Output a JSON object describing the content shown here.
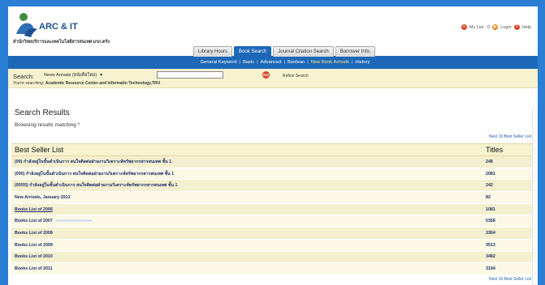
{
  "header": {
    "logo_text": "ARC & IT",
    "logo_subtitle": "สำนักวิทยบริการและเทคโนโลยีสารสนเทศ มรภ.ตรัง",
    "links": [
      "My List - 0",
      "Login",
      "Help"
    ]
  },
  "tabs": [
    {
      "label": "Library Hours",
      "active": false
    },
    {
      "label": "Book Search",
      "active": true
    },
    {
      "label": "Journal Citation Search",
      "active": false
    },
    {
      "label": "Borrower Info.",
      "active": false
    }
  ],
  "nav": {
    "items": [
      "General Keyword",
      "Basic",
      "Advanced",
      "Boolean",
      "New Book Arrivals",
      "History"
    ],
    "current": "New Book Arrivals"
  },
  "search": {
    "label": "Search:",
    "selected_option": "News Arrivals (หนังสือใหม่)",
    "input_value": "",
    "go_label": "GO",
    "refine_label": "Refine Search",
    "searching_prefix": "You're searching:",
    "searching_value": "Academic Resource Center and Informatin Technology,TRU"
  },
  "results": {
    "title": "Search Results",
    "browsing_text": "Browsing results matching *",
    "next_label": "Next 10 Best Seller List",
    "table": {
      "col_list": "Best Seller List",
      "col_titles": "Titles",
      "rows": [
        {
          "name": "(00) กำลังอยู่ในขั้นดำเนินการ สนใจติดต่อฝ่ายงานวิเคราะห์ทรัพยากรสารสนเทศ ชั้น 1",
          "count": "248",
          "link": false
        },
        {
          "name": "(000) กำลังอยู่ในขั้นดำเนินการ สนใจติดต่อฝ่ายงานวิเคราะห์ทรัพยากรสารสนเทศ ชั้น 1",
          "count": "2081",
          "link": false
        },
        {
          "name": "(00/55) กำลังอยู่ในขั้นดำเนินการ สนใจติดต่อฝ่ายงานวิเคราะห์ทรัพยากรสารสนเทศ ชั้น 1",
          "count": "242",
          "link": false
        },
        {
          "name": "New Arrivals, January 2013",
          "count": "82",
          "link": false
        },
        {
          "name": "Books List of 2006",
          "count": "1081",
          "link": true
        },
        {
          "name": "Books List of 2007",
          "count": "5358",
          "link": false
        },
        {
          "name": "Books List of 2008",
          "count": "3364",
          "link": false
        },
        {
          "name": "Books List of 2009",
          "count": "3513",
          "link": false
        },
        {
          "name": "Books List of 2010",
          "count": "3482",
          "link": false
        },
        {
          "name": "Books List of 2011",
          "count": "3194",
          "link": false
        }
      ]
    }
  }
}
